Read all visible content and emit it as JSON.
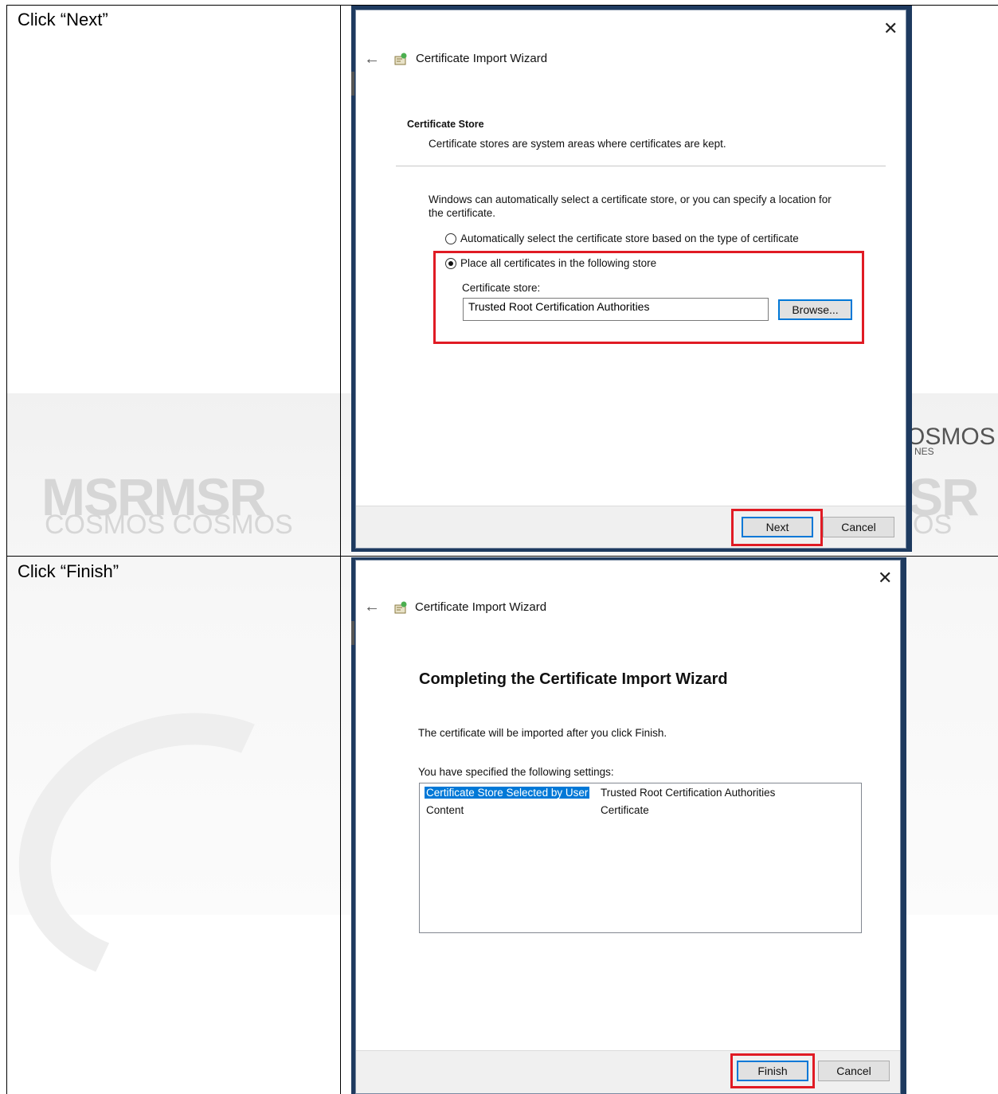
{
  "watermark": {
    "line1": "MSRMSR",
    "line2": "COSMOS COSMOS",
    "right_top": "OSMOS",
    "right_sub": "NES",
    "right_big": "SR",
    "right_small": "OS"
  },
  "rows": [
    {
      "instruction": "Click “Next”",
      "dialog": {
        "title": "Certificate Import Wizard",
        "section_title": "Certificate Store",
        "section_desc": "Certificate stores are system areas where certificates are kept.",
        "intro_line1": "Windows can automatically select a certificate store, or you can specify a location for",
        "intro_line2": "the certificate.",
        "radio_auto": "Automatically select the certificate store based on the type of certificate",
        "radio_place": "Place all certificates in the following store",
        "store_label": "Certificate store:",
        "store_value": "Trusted Root Certification Authorities",
        "browse": "Browse...",
        "next": "Next",
        "cancel": "Cancel"
      }
    },
    {
      "instruction": "Click “Finish”",
      "dialog": {
        "title": "Certificate Import Wizard",
        "heading": "Completing the Certificate Import Wizard",
        "info": "The certificate will be imported after you click Finish.",
        "settings_label": "You have specified the following settings:",
        "settings": [
          {
            "name": "Certificate Store Selected by User",
            "value": "Trusted Root Certification Authorities"
          },
          {
            "name": "Content",
            "value": "Certificate"
          }
        ],
        "finish": "Finish",
        "cancel": "Cancel"
      }
    }
  ],
  "colors": {
    "highlight_red": "#e01b24",
    "selection_blue": "#0078d7",
    "dialog_frame": "#1e3a5f"
  }
}
